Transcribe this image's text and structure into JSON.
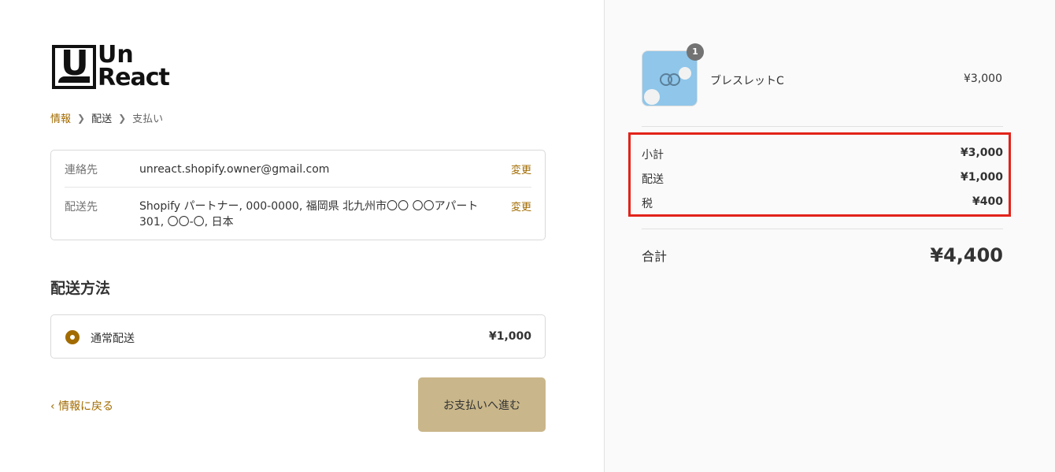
{
  "logo": {
    "line1": "Un",
    "line2": "React",
    "mark": "U"
  },
  "breadcrumb": [
    {
      "label": "情報",
      "state": "link"
    },
    {
      "label": "配送",
      "state": "current"
    },
    {
      "label": "支払い",
      "state": "upcoming"
    }
  ],
  "review": {
    "contact_label": "連絡先",
    "contact_value": "unreact.shopify.owner@gmail.com",
    "contact_change": "変更",
    "ship_label": "配送先",
    "ship_value": "Shopify パートナー, 000-0000, 福岡県 北九州市〇〇 〇〇アパート301, 〇〇-〇, 日本",
    "ship_change": "変更"
  },
  "shipping_method": {
    "title": "配送方法",
    "option_label": "通常配送",
    "option_price": "¥1,000",
    "selected": true
  },
  "actions": {
    "back_label": "情報に戻る",
    "continue_label": "お支払いへ進む"
  },
  "summary": {
    "product": {
      "name": "ブレスレットC",
      "price": "¥3,000",
      "quantity": "1"
    },
    "lines": [
      {
        "label": "小計",
        "amount": "¥3,000"
      },
      {
        "label": "配送",
        "amount": "¥1,000"
      },
      {
        "label": "税",
        "amount": "¥400"
      }
    ],
    "total_label": "合計",
    "total_amount": "¥4,400"
  },
  "colors": {
    "accent": "#a26b00",
    "button": "#c9b68a",
    "highlight": "#e2231a"
  }
}
